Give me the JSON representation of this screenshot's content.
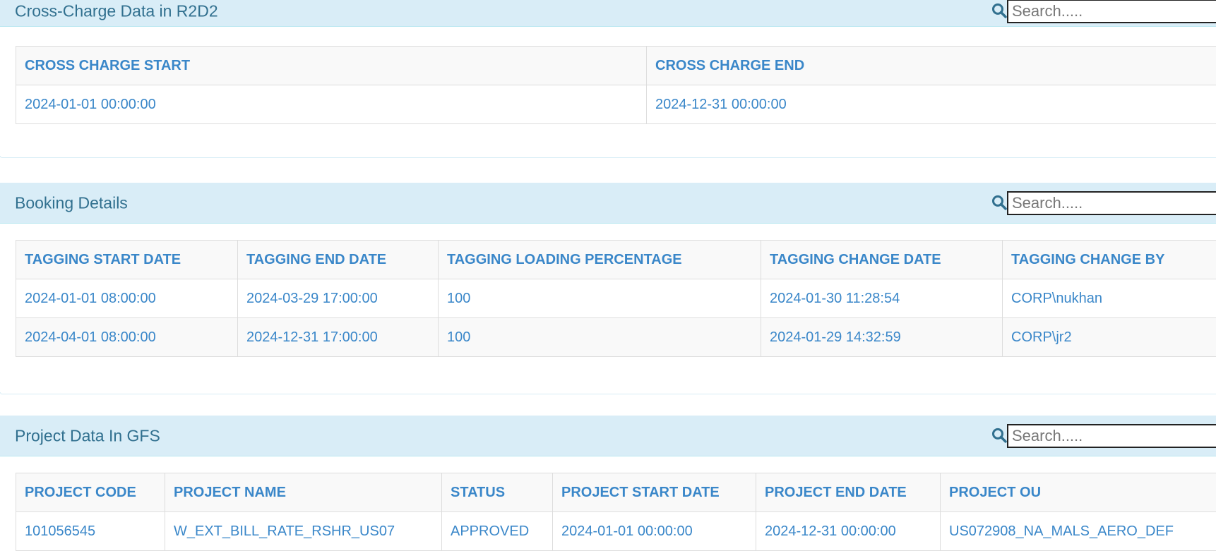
{
  "sections": {
    "cross_charge": {
      "title": "Cross-Charge Data in R2D2",
      "search_placeholder": "Search.....",
      "columns": [
        "CROSS CHARGE START",
        "CROSS CHARGE END"
      ],
      "rows": [
        [
          "2024-01-01 00:00:00",
          "2024-12-31 00:00:00"
        ]
      ]
    },
    "booking": {
      "title": "Booking Details",
      "search_placeholder": "Search.....",
      "columns": [
        "TAGGING START DATE",
        "TAGGING END DATE",
        "TAGGING LOADING PERCENTAGE",
        "TAGGING CHANGE DATE",
        "TAGGING CHANGE BY"
      ],
      "rows": [
        [
          "2024-01-01 08:00:00",
          "2024-03-29 17:00:00",
          "100",
          "2024-01-30 11:28:54",
          "CORP\\nukhan"
        ],
        [
          "2024-04-01 08:00:00",
          "2024-12-31 17:00:00",
          "100",
          "2024-01-29 14:32:59",
          "CORP\\jr2"
        ]
      ]
    },
    "project": {
      "title": "Project Data In GFS",
      "search_placeholder": "Search.....",
      "columns": [
        "PROJECT CODE",
        "PROJECT NAME",
        "STATUS",
        "PROJECT START DATE",
        "PROJECT END DATE",
        "PROJECT OU"
      ],
      "rows": [
        [
          "101056545",
          "W_EXT_BILL_RATE_RSHR_US07",
          "APPROVED",
          "2024-01-01 00:00:00",
          "2024-12-31 00:00:00",
          "US072908_NA_MALS_AERO_DEF"
        ]
      ]
    }
  },
  "colors": {
    "heading_bg": "#d9edf7",
    "heading_text": "#31708f",
    "link_text": "#3a87c9",
    "table_border": "#dddddd",
    "stripe_bg": "#f9f9f9"
  },
  "icons": {
    "search": "search-icon"
  }
}
